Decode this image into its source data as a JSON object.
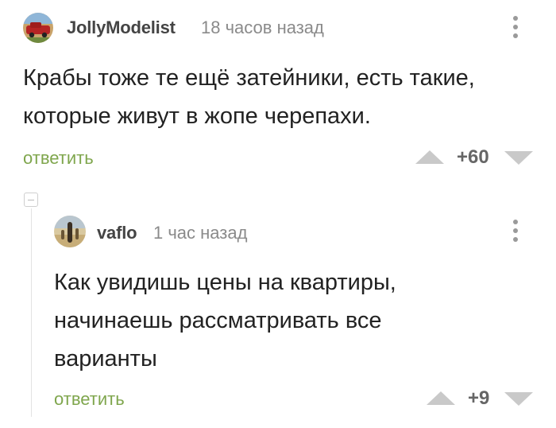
{
  "comments": [
    {
      "username": "JollyModelist",
      "time": "18 часов назад",
      "text_lines": [
        "Крабы тоже те ещё затейники, есть такие,",
        "которые живут в жопе черепахи."
      ],
      "reply_label": "ответить",
      "rating": "+60"
    },
    {
      "username": "vaflo",
      "time": "1 час назад",
      "text_lines": [
        "Как увидишь цены на квартиры,",
        "начинаешь рассматривать все",
        "варианты"
      ],
      "reply_label": "ответить",
      "rating": "+9"
    }
  ],
  "icons": {
    "upvote": "triangle-up-icon",
    "downvote": "triangle-down-icon",
    "menu": "kebab-menu-icon",
    "collapse": "collapse-thread-icon"
  },
  "colors": {
    "reply": "#7fa64d",
    "vote_arrow": "#c9c9c9",
    "meta": "#8a8a8a"
  }
}
